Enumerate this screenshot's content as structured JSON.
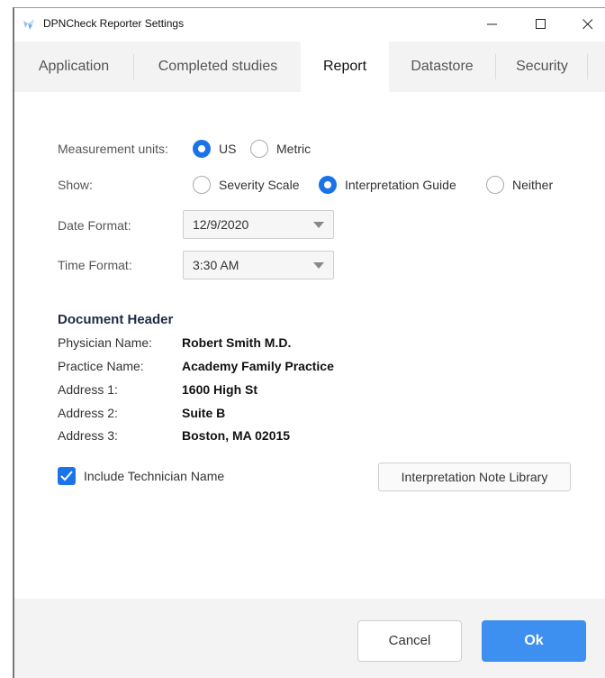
{
  "window": {
    "title": "DPNCheck Reporter Settings",
    "controls": [
      "minimize-icon",
      "maximize-icon",
      "close-icon"
    ]
  },
  "tabs": [
    {
      "label": "Application",
      "active": false
    },
    {
      "label": "Completed studies",
      "active": false
    },
    {
      "label": "Report",
      "active": true
    },
    {
      "label": "Datastore",
      "active": false
    },
    {
      "label": "Security",
      "active": false
    }
  ],
  "measurement": {
    "label": "Measurement units:",
    "options": [
      {
        "label": "US",
        "selected": true
      },
      {
        "label": "Metric",
        "selected": false
      }
    ]
  },
  "show": {
    "label": "Show:",
    "options": [
      {
        "label": "Severity Scale",
        "selected": false
      },
      {
        "label": "Interpretation Guide",
        "selected": true
      },
      {
        "label": "Neither",
        "selected": false
      }
    ]
  },
  "date_format": {
    "label": "Date Format:",
    "value": "12/9/2020"
  },
  "time_format": {
    "label": "Time Format:",
    "value": "3:30 AM"
  },
  "document_header": {
    "title": "Document Header",
    "fields": [
      {
        "label": "Physician Name:",
        "value": "Robert Smith M.D."
      },
      {
        "label": "Practice Name:",
        "value": "Academy Family Practice"
      },
      {
        "label": "Address 1:",
        "value": "1600 High St"
      },
      {
        "label": "Address 2:",
        "value": "Suite B"
      },
      {
        "label": "Address 3:",
        "value": "Boston, MA 02015"
      }
    ]
  },
  "include_technician": {
    "label": "Include Technician Name",
    "checked": true
  },
  "library_button": {
    "label": "Interpretation Note Library"
  },
  "footer": {
    "cancel_label": "Cancel",
    "ok_label": "Ok"
  },
  "colors": {
    "accent": "#1a73e8",
    "ok_button": "#3d8ff0",
    "tab_strip": "#f3f3f3"
  }
}
